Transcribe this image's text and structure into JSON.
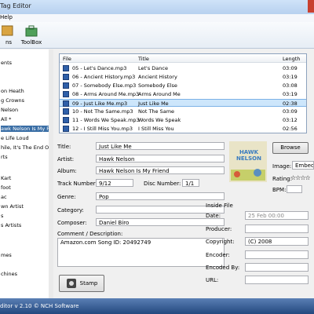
{
  "window": {
    "title": "Tag Editor"
  },
  "menu": {
    "help": "Help"
  },
  "toolbar": {
    "options_label": "ns",
    "toolbox_label": "ToolBox"
  },
  "sidebar": {
    "items": [
      "ents",
      "",
      "",
      "on Heath",
      "g Crowns",
      "Nelson",
      "All *",
      "awk Nelson Is My Fri",
      "e Life Loud",
      "hile, It's The End Of",
      "rts",
      "",
      "",
      "Kart",
      "foot",
      "ac",
      "wn Artist",
      "s",
      "s Artists",
      "",
      "mes",
      "",
      "chines"
    ]
  },
  "filelist": {
    "columns": [
      "File",
      "Title",
      "Length"
    ],
    "rows": [
      {
        "file": "05 - Let's Dance.mp3",
        "title": "Let's Dance",
        "length": "03:09",
        "selected": false
      },
      {
        "file": "06 - Ancient History.mp3",
        "title": "Ancient History",
        "length": "03:19",
        "selected": false
      },
      {
        "file": "07 - Somebody Else.mp3",
        "title": "Somebody Else",
        "length": "03:08",
        "selected": false
      },
      {
        "file": "08 - Arms Around Me.mp3",
        "title": "Arms Around Me",
        "length": "03:19",
        "selected": false
      },
      {
        "file": "09 - Just Like Me.mp3",
        "title": "Just Like Me",
        "length": "02:38",
        "selected": true
      },
      {
        "file": "10 - Not The Same.mp3",
        "title": "Not The Same",
        "length": "03:09",
        "selected": false
      },
      {
        "file": "11 - Words We Speak.mp3",
        "title": "Words We Speak",
        "length": "03:12",
        "selected": false
      },
      {
        "file": "12 - I Still Miss You.mp3",
        "title": "I Still Miss You",
        "length": "02:56",
        "selected": false
      }
    ]
  },
  "tags": {
    "title_label": "Title:",
    "title_value": "Just Like Me",
    "artist_label": "Artist:",
    "artist_value": "Hawk Nelson",
    "album_label": "Album:",
    "album_value": "Hawk Nelson Is My Friend",
    "track_label": "Track Number:",
    "track_value": "9/12",
    "disc_label": "Disc Number:",
    "disc_value": "1/1",
    "genre_label": "Genre:",
    "genre_value": "Pop",
    "category_label": "Category:",
    "category_value": "",
    "composer_label": "Composer:",
    "composer_value": "Daniel Biro",
    "comment_label": "Comment / Description:",
    "comment_value": "Amazon.com Song ID: 20492749",
    "stamp_label": "Stamp"
  },
  "artwork": {
    "browse_label": "Browse",
    "image_label": "Image:",
    "image_value": "Embedd",
    "rating_label": "Rating:",
    "rating_stars": "☆☆☆☆",
    "bpm_label": "BPM:",
    "art_text": "HAWK NELSON"
  },
  "inside_file": {
    "heading": "Inside File",
    "date_label": "Date:",
    "date_value": "25 Feb 00:00",
    "producer_label": "Producer:",
    "copyright_label": "Copyright:",
    "copyright_value": "(C) 2008",
    "encoder_label": "Encoder:",
    "encoded_by_label": "Encoded By:",
    "url_label": "URL:"
  },
  "status": {
    "text": "ditor v 2.10 © NCH Software"
  },
  "colors": {
    "accent": "#3a6ea5",
    "selected_row": "#cde6fb"
  }
}
